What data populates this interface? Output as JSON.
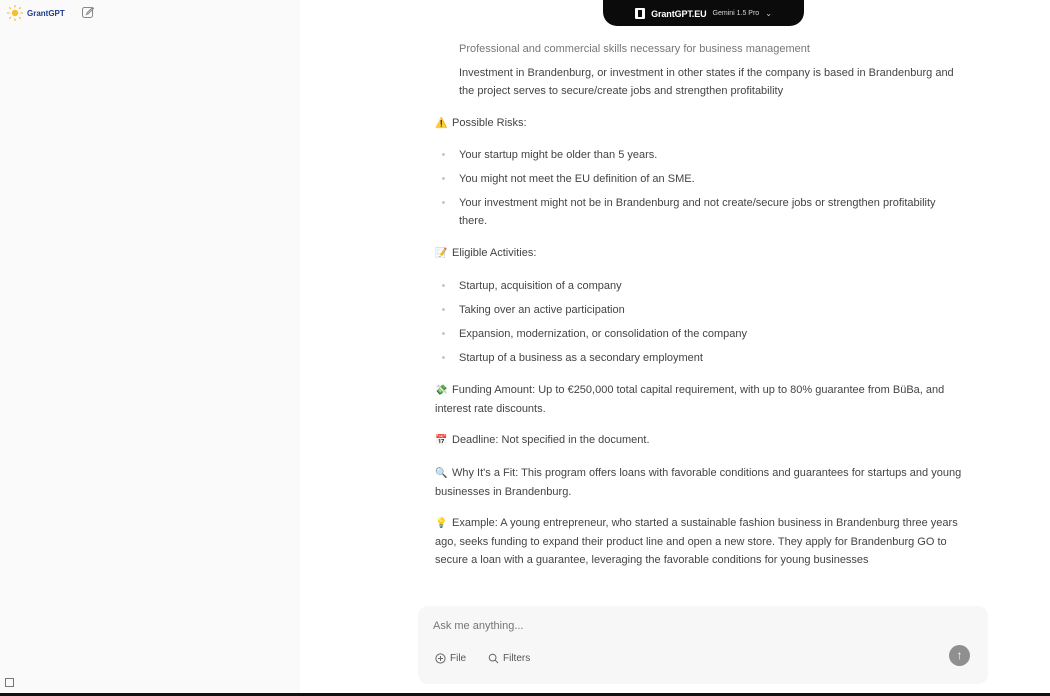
{
  "app": {
    "logo_text": "GrantGPT",
    "logo_icon": "sun-logo",
    "new_chat_icon": "edit-icon",
    "sidebar_toggle_icon": "sidebar-toggle-icon"
  },
  "model_selector": {
    "brand": "GrantGPT.EU",
    "model": "Gemini 1.5 Pro",
    "icon": "book-icon"
  },
  "message": {
    "requirements_tail": [
      "Professional and commercial skills necessary for business management",
      "Investment in Brandenburg, or investment in other states if the company is based in Brandenburg and the project serves to secure/create jobs and strengthen profitability"
    ],
    "risks": {
      "emoji": "⚠️",
      "title": "Possible Risks:",
      "items": [
        "Your startup might be older than 5 years.",
        "You might not meet the EU definition of an SME.",
        "Your investment might not be in Brandenburg and not create/secure jobs or strengthen profitability there."
      ]
    },
    "activities": {
      "emoji": "📝",
      "title": "Eligible Activities:",
      "items": [
        "Startup, acquisition of a company",
        "Taking over an active participation",
        "Expansion, modernization, or consolidation of the company",
        "Startup of a business as a secondary employment"
      ]
    },
    "funding": {
      "emoji": "💸",
      "text": "Funding Amount: Up to €250,000 total capital requirement, with up to 80% guarantee from BüBa, and interest rate discounts."
    },
    "deadline": {
      "emoji": "📅",
      "text": "Deadline: Not specified in the document."
    },
    "fit": {
      "emoji": "🔍",
      "text": "Why It's a Fit: This program offers loans with favorable conditions and guarantees for startups and young businesses in Brandenburg."
    },
    "example": {
      "emoji": "💡",
      "text": "Example: A young entrepreneur, who started a sustainable fashion business in Brandenburg three years ago, seeks funding to expand their product line and open a new store. They apply for Brandenburg GO to secure a loan with a guarantee, leveraging the favorable conditions for young businesses"
    }
  },
  "composer": {
    "placeholder": "Ask me anything...",
    "file_label": "File",
    "filters_label": "Filters",
    "send_icon": "arrow-up-icon"
  }
}
